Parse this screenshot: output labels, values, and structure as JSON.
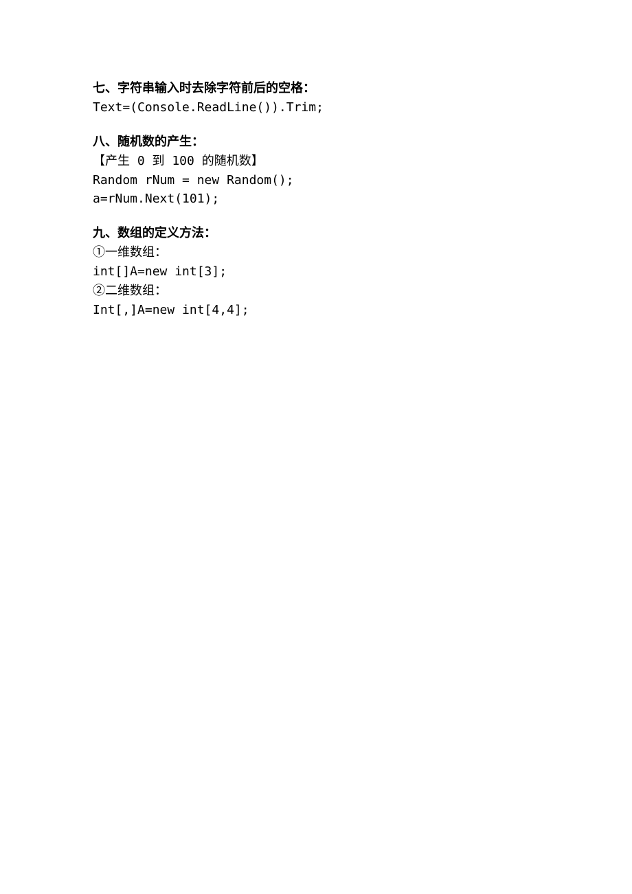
{
  "sections": [
    {
      "heading": "七、字符串输入时去除字符前后的空格：",
      "lines": [
        "Text=(Console.ReadLine()).Trim;"
      ]
    },
    {
      "heading": "八、随机数的产生：",
      "lines": [
        "【产生 0 到 100 的随机数】",
        "Random rNum = new Random();",
        "a=rNum.Next(101);"
      ]
    },
    {
      "heading": "九、数组的定义方法：",
      "lines": [
        "①一维数组：",
        "int[]A=new int[3];",
        "②二维数组：",
        "Int[,]A=new int[4,4];"
      ]
    }
  ]
}
